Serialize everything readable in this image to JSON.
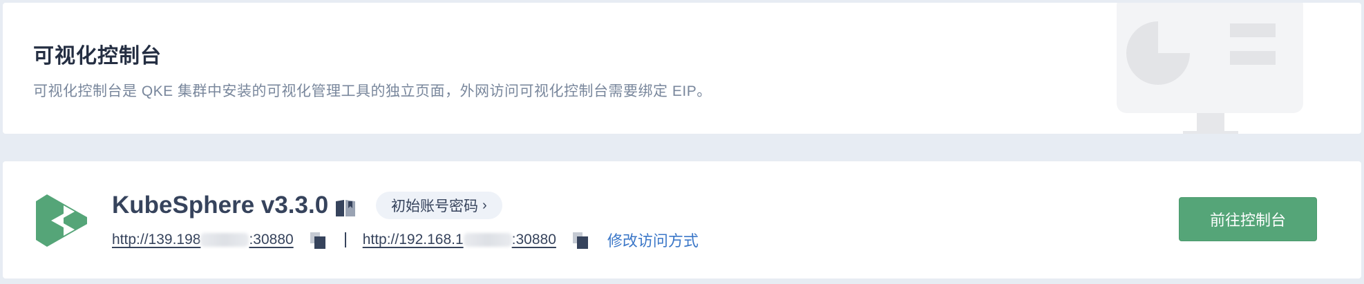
{
  "banner": {
    "title": "可视化控制台",
    "description": "可视化控制台是 QKE 集群中安装的可视化管理工具的独立页面，外网访问可视化控制台需要绑定 EIP。"
  },
  "console": {
    "logo_icon": "kubesphere-logo",
    "name": "KubeSphere v3.3.0",
    "doc_icon": "book-icon",
    "account_button_label": "初始账号密码",
    "account_chevron": "›",
    "public_url_prefix": "http://139.198",
    "public_url_suffix": ":30880",
    "private_url_prefix": "http://192.168.1",
    "private_url_suffix": ":30880",
    "copy_icon": "copy-icon",
    "separator": "|",
    "modify_link": "修改访问方式",
    "go_button_label": "前往控制台"
  },
  "colors": {
    "page_bg": "#e7ecf3",
    "title": "#242e42",
    "desc": "#79879c",
    "accent_green": "#55a578",
    "link_blue": "#3b77c8"
  }
}
